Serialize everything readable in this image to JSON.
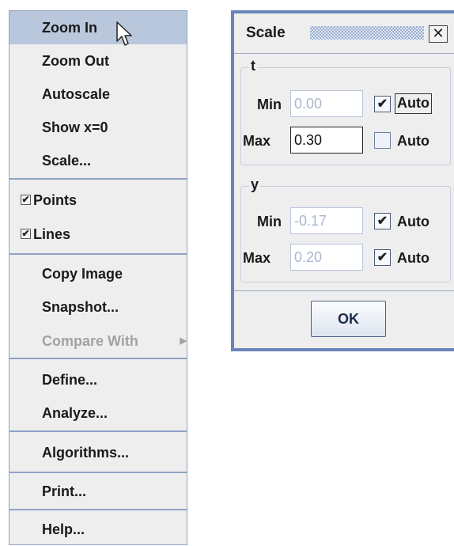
{
  "menu": {
    "items": [
      {
        "label": "Zoom In"
      },
      {
        "label": "Zoom Out"
      },
      {
        "label": "Autoscale"
      },
      {
        "label": "Show x=0"
      },
      {
        "label": "Scale..."
      },
      {
        "label": "Points",
        "checked": true
      },
      {
        "label": "Lines",
        "checked": true
      },
      {
        "label": "Copy Image"
      },
      {
        "label": "Snapshot..."
      },
      {
        "label": "Compare With",
        "disabled": true,
        "submenu_icon": "right-triangle-icon"
      },
      {
        "label": "Define..."
      },
      {
        "label": "Analyze..."
      },
      {
        "label": "Algorithms..."
      },
      {
        "label": "Print..."
      },
      {
        "label": "Help..."
      }
    ],
    "highlighted": "Zoom In",
    "check_glyph": "✔",
    "submenu_glyph": "▶"
  },
  "dialog": {
    "title": "Scale",
    "close_glyph": "✕",
    "groups": {
      "t": {
        "label": "t",
        "min": {
          "label": "Min",
          "value": "0.00",
          "auto": true,
          "auto_label": "Auto"
        },
        "max": {
          "label": "Max",
          "value": "0.30",
          "auto": false,
          "auto_label": "Auto"
        }
      },
      "y": {
        "label": "y",
        "min": {
          "label": "Min",
          "value": "-0.17",
          "auto": true,
          "auto_label": "Auto"
        },
        "max": {
          "label": "Max",
          "value": "0.20",
          "auto": true,
          "auto_label": "Auto"
        }
      }
    },
    "ok_label": "OK",
    "check_glyph": "✔"
  },
  "colors": {
    "menu_bg": "#eeeeee",
    "highlight": "#b8c7dc",
    "separator": "#8fa3c4",
    "disabled_text": "#a2a2a2",
    "dialog_border": "#6a84b8"
  }
}
